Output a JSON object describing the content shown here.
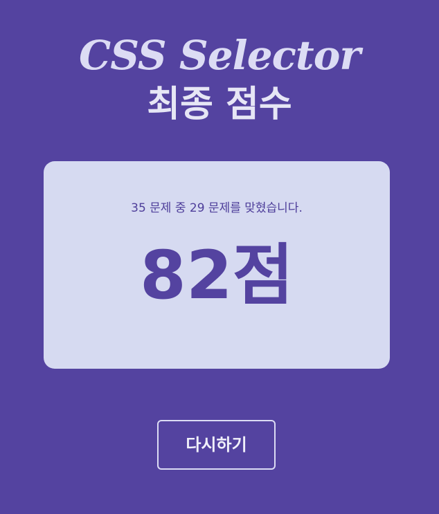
{
  "header": {
    "logo_title": "CSS Selector",
    "subtitle": "최종 점수"
  },
  "result": {
    "summary": "35 문제 중 29 문제를 맞혔습니다.",
    "score": "82점",
    "total_questions": 35,
    "correct_answers": 29
  },
  "actions": {
    "retry_label": "다시하기"
  },
  "colors": {
    "background": "#5443a0",
    "card": "#d6daf1",
    "accent": "#5443a0",
    "title": "#dcdcf4"
  }
}
